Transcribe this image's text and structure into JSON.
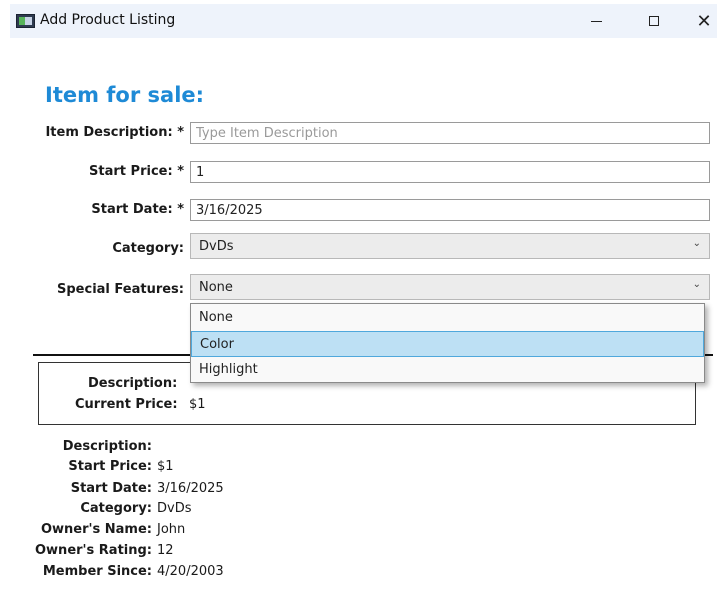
{
  "window": {
    "title": "Add Product Listing",
    "controls": {
      "minimize": "minimize",
      "maximize": "maximize",
      "close": "✕"
    }
  },
  "heading": "Item for sale:",
  "form": {
    "item_description": {
      "label": "Item Description: *",
      "value": "",
      "placeholder": "Type Item Description"
    },
    "start_price": {
      "label": "Start Price: *",
      "value": "1"
    },
    "start_date": {
      "label": "Start Date: *",
      "value": "3/16/2025"
    },
    "category": {
      "label": "Category:",
      "value": "DvDs"
    },
    "special_features": {
      "label": "Special Features:",
      "value": "None",
      "options": [
        "None",
        "Color",
        "Highlight"
      ],
      "highlighted_option": "Color"
    }
  },
  "summary": {
    "description_label": "Description:",
    "description_value": "",
    "current_price_label": "Current Price:",
    "current_price_value": "$1"
  },
  "details": {
    "description": {
      "label": "Description:",
      "value": ""
    },
    "start_price": {
      "label": "Start Price:",
      "value": "$1"
    },
    "start_date": {
      "label": "Start Date:",
      "value": "3/16/2025"
    },
    "category": {
      "label": "Category:",
      "value": "DvDs"
    },
    "owner_name": {
      "label": "Owner's Name:",
      "value": "John"
    },
    "owner_rating": {
      "label": "Owner's Rating:",
      "value": "12"
    },
    "member_since": {
      "label": "Member Since:",
      "value": "4/20/2003"
    }
  },
  "icons": {
    "app": "app-window-icon",
    "dropdown": "chevron-down-icon"
  },
  "colors": {
    "heading": "#1e8ad6",
    "selection": "#bde0f4",
    "selection_border": "#4fa8dc",
    "titlebar": "#eef3fb"
  }
}
